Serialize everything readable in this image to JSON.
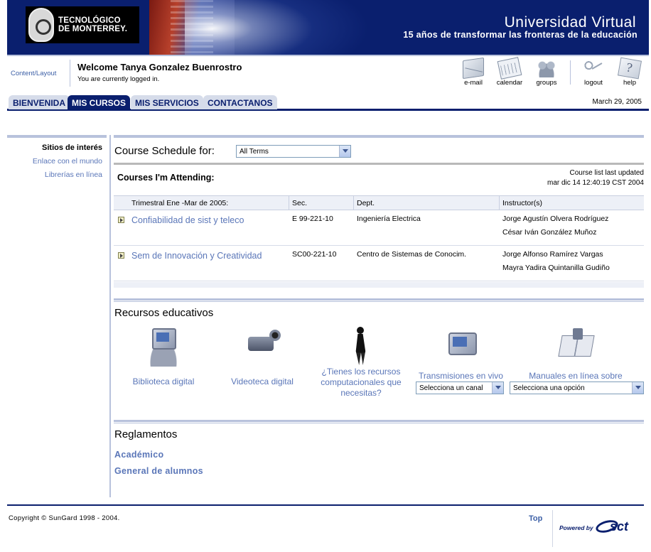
{
  "banner": {
    "logo_line1": "TECNOLÓGICO",
    "logo_line2": "DE MONTERREY.",
    "title": "Universidad Virtual",
    "subtitle": "15 años de transformar las fronteras de la educación"
  },
  "userbar": {
    "content_layout": "Content/Layout",
    "welcome": "Welcome Tanya Gonzalez Buenrostro",
    "status": "You are currently logged in.",
    "tools": [
      {
        "label": "e-mail",
        "icon": "email-icon"
      },
      {
        "label": "calendar",
        "icon": "calendar-icon"
      },
      {
        "label": "groups",
        "icon": "groups-icon"
      },
      {
        "label": "logout",
        "icon": "logout-icon"
      },
      {
        "label": "help",
        "icon": "help-icon"
      }
    ]
  },
  "tabs": [
    {
      "label": "BIENVENIDA",
      "active": false
    },
    {
      "label": "MIS CURSOS",
      "active": true
    },
    {
      "label": "MIS SERVICIOS",
      "active": false
    },
    {
      "label": "CONTACTANOS",
      "active": false
    }
  ],
  "date": "March 29, 2005",
  "sidebar": {
    "heading": "Sitios de interés",
    "links": [
      "Enlace con el mundo",
      "Librerías en línea"
    ]
  },
  "schedule": {
    "title": "Course Schedule for:",
    "term_selected": "All Terms",
    "attending_title": "Courses I'm Attending:",
    "updated_line1": "Course list last updated",
    "updated_line2": "mar dic 14 12:40:19 CST 2004",
    "columns": [
      "Trimestral Ene -Mar de 2005:",
      "Sec.",
      "Dept.",
      "Instructor(s)"
    ],
    "courses": [
      {
        "name": "Confiabilidad de sist y teleco",
        "section": "E 99-221-10",
        "dept": "Ingeniería Electrica",
        "instructor1": "Jorge Agustín Olvera Rodríguez",
        "instructor2": "César Iván González Muñoz"
      },
      {
        "name": "Sem de Innovación y Creatividad",
        "section": "SC00-221-10",
        "dept": "Centro de Sistemas de Conocim.",
        "instructor1": "Jorge Alfonso Ramírez Vargas",
        "instructor2": "Mayra Yadira Quintanilla Gudiño"
      }
    ]
  },
  "recursos": {
    "title": "Recursos educativos",
    "items": [
      {
        "label": "Biblioteca digital",
        "icon": "computer-icon"
      },
      {
        "label": "Videoteca digital",
        "icon": "video-camera-icon"
      },
      {
        "label": "¿Tienes los recursos computacionales que necesitas?",
        "icon": "person-icon"
      },
      {
        "label": "Transmisiones en vivo",
        "icon": "tv-icon",
        "select": "Selecciona un canal"
      },
      {
        "label": "Manuales en línea sobre",
        "icon": "book-icon",
        "select": "Selecciona una opción"
      }
    ]
  },
  "reglamentos": {
    "title": "Reglamentos",
    "links": [
      "Académico",
      "General de alumnos"
    ]
  },
  "footer": {
    "copyright": "Copyright © SunGard 1998 - 2004.",
    "top": "Top",
    "powered": "Powered by",
    "brand": "sct"
  }
}
